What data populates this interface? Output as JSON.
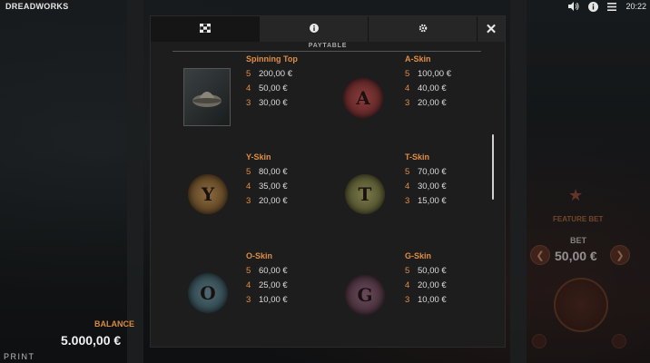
{
  "game": {
    "title": "DREADWORKS"
  },
  "status": {
    "time": "20:22",
    "sound_icon": "speaker-icon",
    "info_icon": "info-icon",
    "menu_icon": "menu-icon"
  },
  "balance": {
    "label": "BALANCE",
    "value": "5.000,00 €"
  },
  "footer": {
    "print_label": "PRINT"
  },
  "controls": {
    "feature_bet_label": "FEATURE BET",
    "bet_label": "BET",
    "bet_value": "50,00 €"
  },
  "modal": {
    "tabs": [
      {
        "icon": "paytable-icon",
        "active": true
      },
      {
        "icon": "info-icon",
        "active": false
      },
      {
        "icon": "settings-icon",
        "active": false
      }
    ],
    "close_label": "✕",
    "section_title": "PAYTABLE",
    "symbols": [
      {
        "name": "Spinning Top",
        "pays": [
          {
            "count": "5",
            "value": "200,00 €"
          },
          {
            "count": "4",
            "value": "50,00 €"
          },
          {
            "count": "3",
            "value": "30,00 €"
          }
        ],
        "letter": ""
      },
      {
        "name": "A-Skin",
        "pays": [
          {
            "count": "5",
            "value": "100,00 €"
          },
          {
            "count": "4",
            "value": "40,00 €"
          },
          {
            "count": "3",
            "value": "20,00 €"
          }
        ],
        "letter": "A"
      },
      {
        "name": "Y-Skin",
        "pays": [
          {
            "count": "5",
            "value": "80,00 €"
          },
          {
            "count": "4",
            "value": "35,00 €"
          },
          {
            "count": "3",
            "value": "20,00 €"
          }
        ],
        "letter": "Y"
      },
      {
        "name": "T-Skin",
        "pays": [
          {
            "count": "5",
            "value": "70,00 €"
          },
          {
            "count": "4",
            "value": "30,00 €"
          },
          {
            "count": "3",
            "value": "15,00 €"
          }
        ],
        "letter": "T"
      },
      {
        "name": "O-Skin",
        "pays": [
          {
            "count": "5",
            "value": "60,00 €"
          },
          {
            "count": "4",
            "value": "25,00 €"
          },
          {
            "count": "3",
            "value": "10,00 €"
          }
        ],
        "letter": "O"
      },
      {
        "name": "G-Skin",
        "pays": [
          {
            "count": "5",
            "value": "50,00 €"
          },
          {
            "count": "4",
            "value": "20,00 €"
          },
          {
            "count": "3",
            "value": "10,00 €"
          }
        ],
        "letter": "G"
      }
    ]
  },
  "colors": {
    "accent": "#e08d45",
    "panel": "#1d1d1d",
    "tab": "#262626"
  }
}
